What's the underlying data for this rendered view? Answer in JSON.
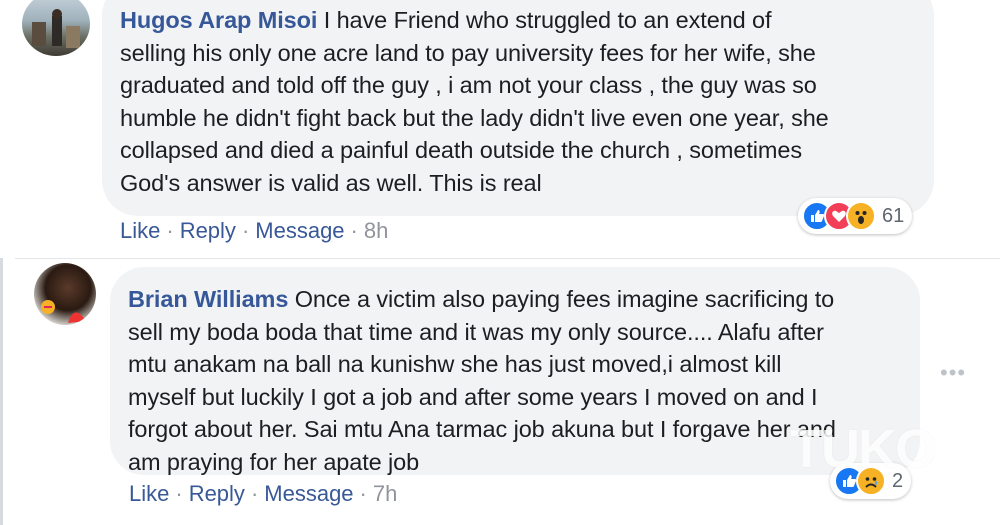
{
  "comments": [
    {
      "author": "Hugos Arap Misoi",
      "text": " I have Friend who struggled to an extend of\nselling his only one acre land to pay university fees for her wife, she\ngraduated and told off the guy , i am not your class , the guy was so\nhumble he didn't fight back but the lady didn't live even one year, she\ncollapsed and died a painful death outside the church , sometimes\nGod's answer is valid as well. This is real",
      "actions": {
        "like": "Like",
        "reply": "Reply",
        "message": "Message",
        "time": "8h"
      },
      "reaction_count": "61",
      "reaction_icons": [
        "like-reaction-icon",
        "love-reaction-icon",
        "wow-reaction-icon"
      ]
    },
    {
      "author": "Brian Williams",
      "text": " Once a victim also paying fees imagine sacrificing to\nsell my boda boda that time and it was my only source.... Alafu after\nmtu anakam na ball na kunishw she has just moved,i almost kill\nmyself but luckily I got a job and after some years I moved on and I\nforgot about her. Sai mtu Ana tarmac job akuna but I forgave her and\nam praying for her apate job",
      "actions": {
        "like": "Like",
        "reply": "Reply",
        "message": "Message",
        "time": "7h"
      },
      "reaction_count": "2",
      "reaction_icons": [
        "like-reaction-icon",
        "sad-reaction-icon"
      ]
    }
  ],
  "more_options": "•••",
  "watermark": "TUKO",
  "colors": {
    "author": "#365899",
    "bubble": "#f2f3f5",
    "link": "#385898",
    "like": "#1877f2",
    "love": "#f33e58",
    "wow": "#f7b125"
  }
}
